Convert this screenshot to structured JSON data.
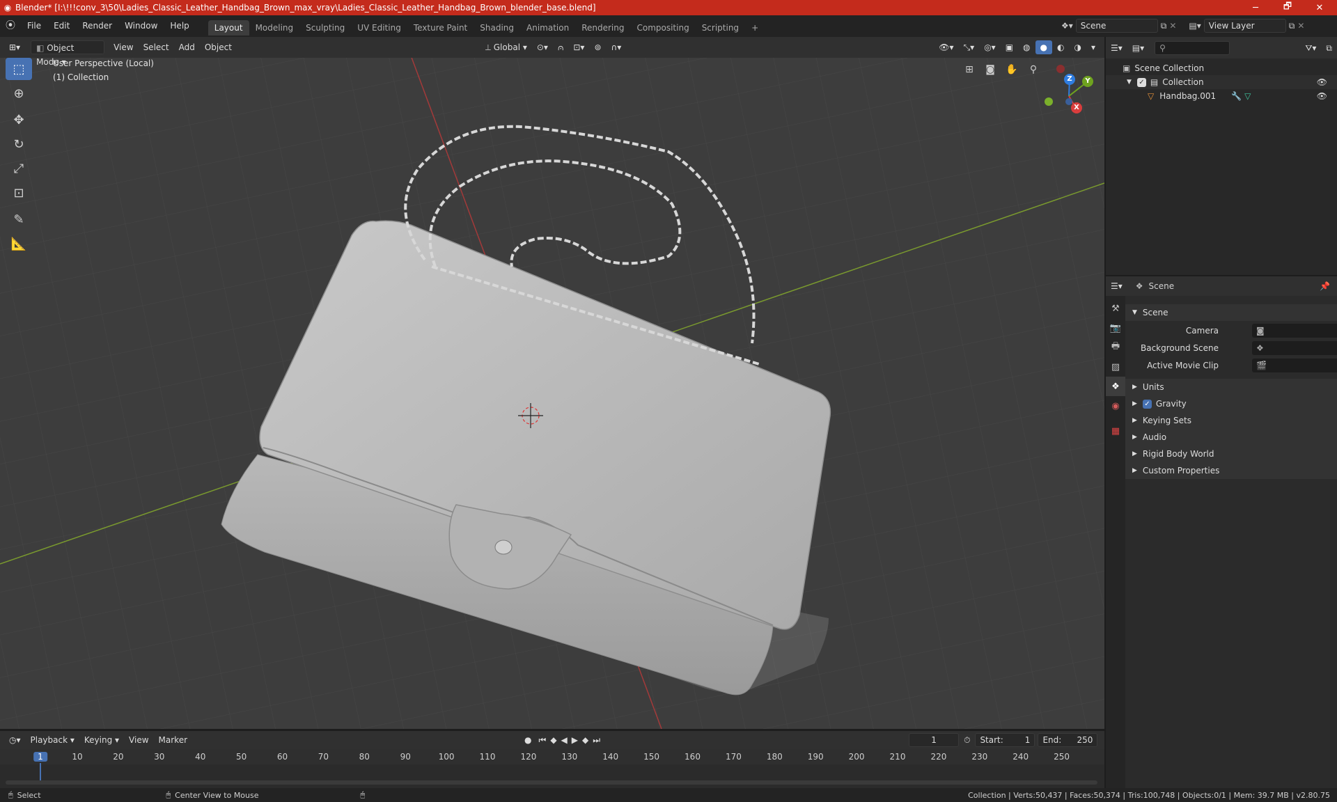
{
  "window": {
    "title": "Blender* [I:\\!!!conv_3\\50\\Ladies_Classic_Leather_Handbag_Brown_max_vray\\Ladies_Classic_Leather_Handbag_Brown_blender_base.blend]",
    "minimize": "─",
    "maximize": "🗗",
    "close": "✕"
  },
  "menu": [
    "File",
    "Edit",
    "Render",
    "Window",
    "Help"
  ],
  "workspaces": [
    "Layout",
    "Modeling",
    "Sculpting",
    "UV Editing",
    "Texture Paint",
    "Shading",
    "Animation",
    "Rendering",
    "Compositing",
    "Scripting"
  ],
  "add_workspace": "+",
  "scene_field": "Scene",
  "viewlayer_field": "View Layer",
  "viewport_header": {
    "mode": "Object Mode",
    "view": "View",
    "select": "Select",
    "add": "Add",
    "object": "Object",
    "transform": "Global"
  },
  "viewport": {
    "perspective": "User Perspective (Local)",
    "collection": "(1) Collection",
    "gizmo": {
      "x": "X",
      "y": "Y",
      "z": "Z"
    }
  },
  "outliner": {
    "search_placeholder": "",
    "scene_collection": "Scene Collection",
    "collection": "Collection",
    "object": "Handbag.001"
  },
  "properties": {
    "header": "Scene",
    "section": "Scene",
    "camera_label": "Camera",
    "bg_scene_label": "Background Scene",
    "movie_clip_label": "Active Movie Clip",
    "panels": [
      "Units",
      "Gravity",
      "Keying Sets",
      "Audio",
      "Rigid Body World",
      "Custom Properties"
    ]
  },
  "timeline": {
    "playback": "Playback",
    "keying": "Keying",
    "view": "View",
    "marker": "Marker",
    "current_frame": "1",
    "start_label": "Start:",
    "start": "1",
    "end_label": "End:",
    "end": "250",
    "ticks": [
      "1",
      "10",
      "20",
      "30",
      "40",
      "50",
      "60",
      "70",
      "80",
      "90",
      "100",
      "110",
      "120",
      "130",
      "140",
      "150",
      "160",
      "170",
      "180",
      "190",
      "200",
      "210",
      "220",
      "230",
      "240",
      "250"
    ]
  },
  "status": {
    "left": "Select",
    "middle": "Center View to Mouse",
    "right": "Collection | Verts:50,437 | Faces:50,374 | Tris:100,748 | Objects:0/1 | Mem: 39.7 MB | v2.80.75"
  }
}
